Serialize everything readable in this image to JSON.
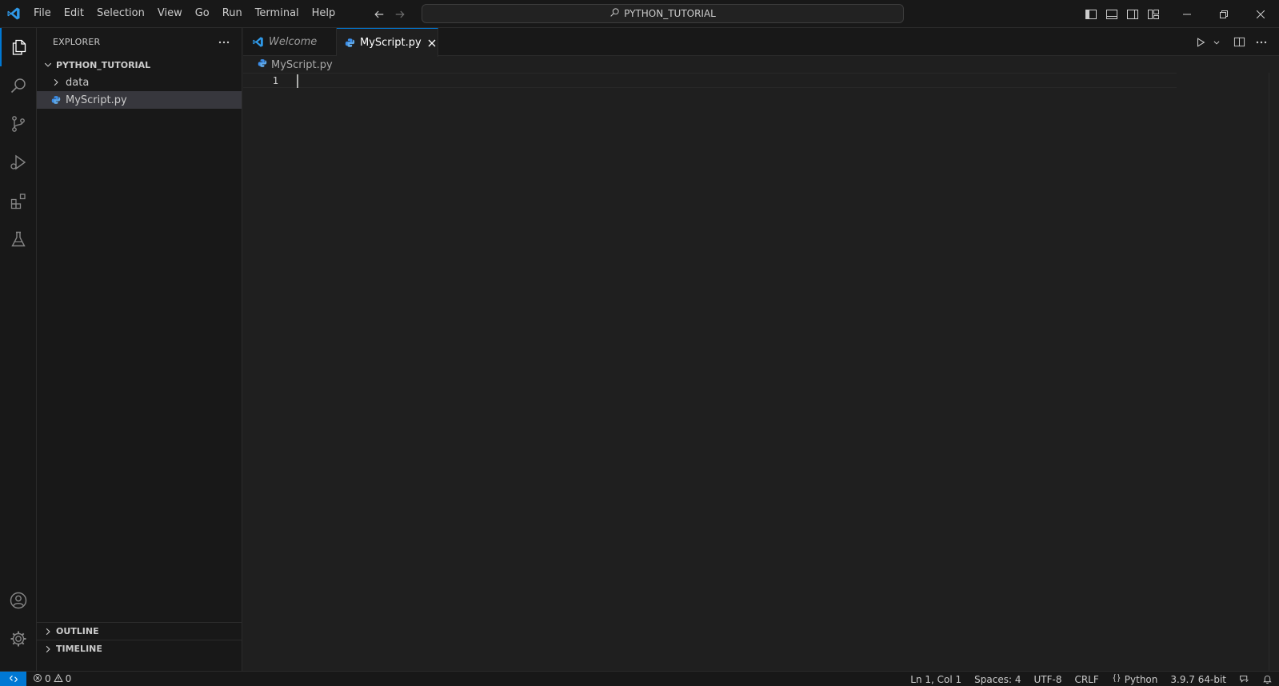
{
  "menu": [
    "File",
    "Edit",
    "Selection",
    "View",
    "Go",
    "Run",
    "Terminal",
    "Help"
  ],
  "command_center": {
    "label": "PYTHON_TUTORIAL"
  },
  "activity": [
    {
      "name": "explorer-icon",
      "active": true
    },
    {
      "name": "search-icon"
    },
    {
      "name": "source-control-icon"
    },
    {
      "name": "run-debug-icon"
    },
    {
      "name": "extensions-icon"
    },
    {
      "name": "testing-icon"
    },
    {
      "name": "account-icon"
    },
    {
      "name": "manage-gear-icon"
    }
  ],
  "sidebar": {
    "title": "EXPLORER",
    "folder": "PYTHON_TUTORIAL",
    "items": [
      {
        "label": "data",
        "type": "folder"
      },
      {
        "label": "MyScript.py",
        "type": "python-file",
        "selected": true
      }
    ],
    "outline": "OUTLINE",
    "timeline": "TIMELINE"
  },
  "tabs": [
    {
      "label": "Welcome",
      "icon": "vscode-icon",
      "active": false
    },
    {
      "label": "MyScript.py",
      "icon": "python-icon",
      "active": true
    }
  ],
  "breadcrumb": "MyScript.py",
  "editor": {
    "line_number": "1"
  },
  "status": {
    "errors": "0",
    "warnings": "0",
    "position": "Ln 1, Col 1",
    "spaces": "Spaces: 4",
    "encoding": "UTF-8",
    "eol": "CRLF",
    "language": "Python",
    "interpreter": "3.9.7 64-bit"
  },
  "colors": {
    "accent": "#0078d4",
    "background": "#1f1f1f",
    "panel": "#181818",
    "python": "#3b8eea"
  }
}
